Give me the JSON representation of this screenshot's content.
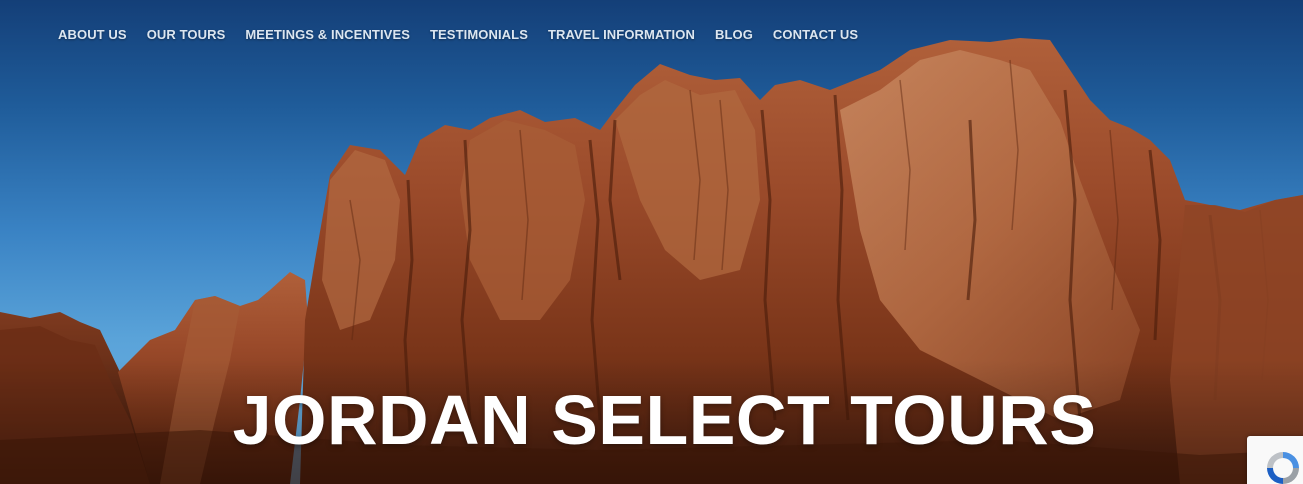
{
  "nav": {
    "items": [
      {
        "label": "ABOUT US"
      },
      {
        "label": "OUR TOURS"
      },
      {
        "label": "MEETINGS & INCENTIVES"
      },
      {
        "label": "TESTIMONIALS"
      },
      {
        "label": "TRAVEL INFORMATION"
      },
      {
        "label": "BLOG"
      },
      {
        "label": "CONTACT US"
      }
    ]
  },
  "hero": {
    "title": "JORDAN SELECT TOURS",
    "background_image": "wadi-rum-sandstone-cliffs",
    "sky_color": "#1f5c9a",
    "rock_color": "#8a3f22"
  },
  "recaptcha": {
    "icon": "recaptcha-icon"
  }
}
